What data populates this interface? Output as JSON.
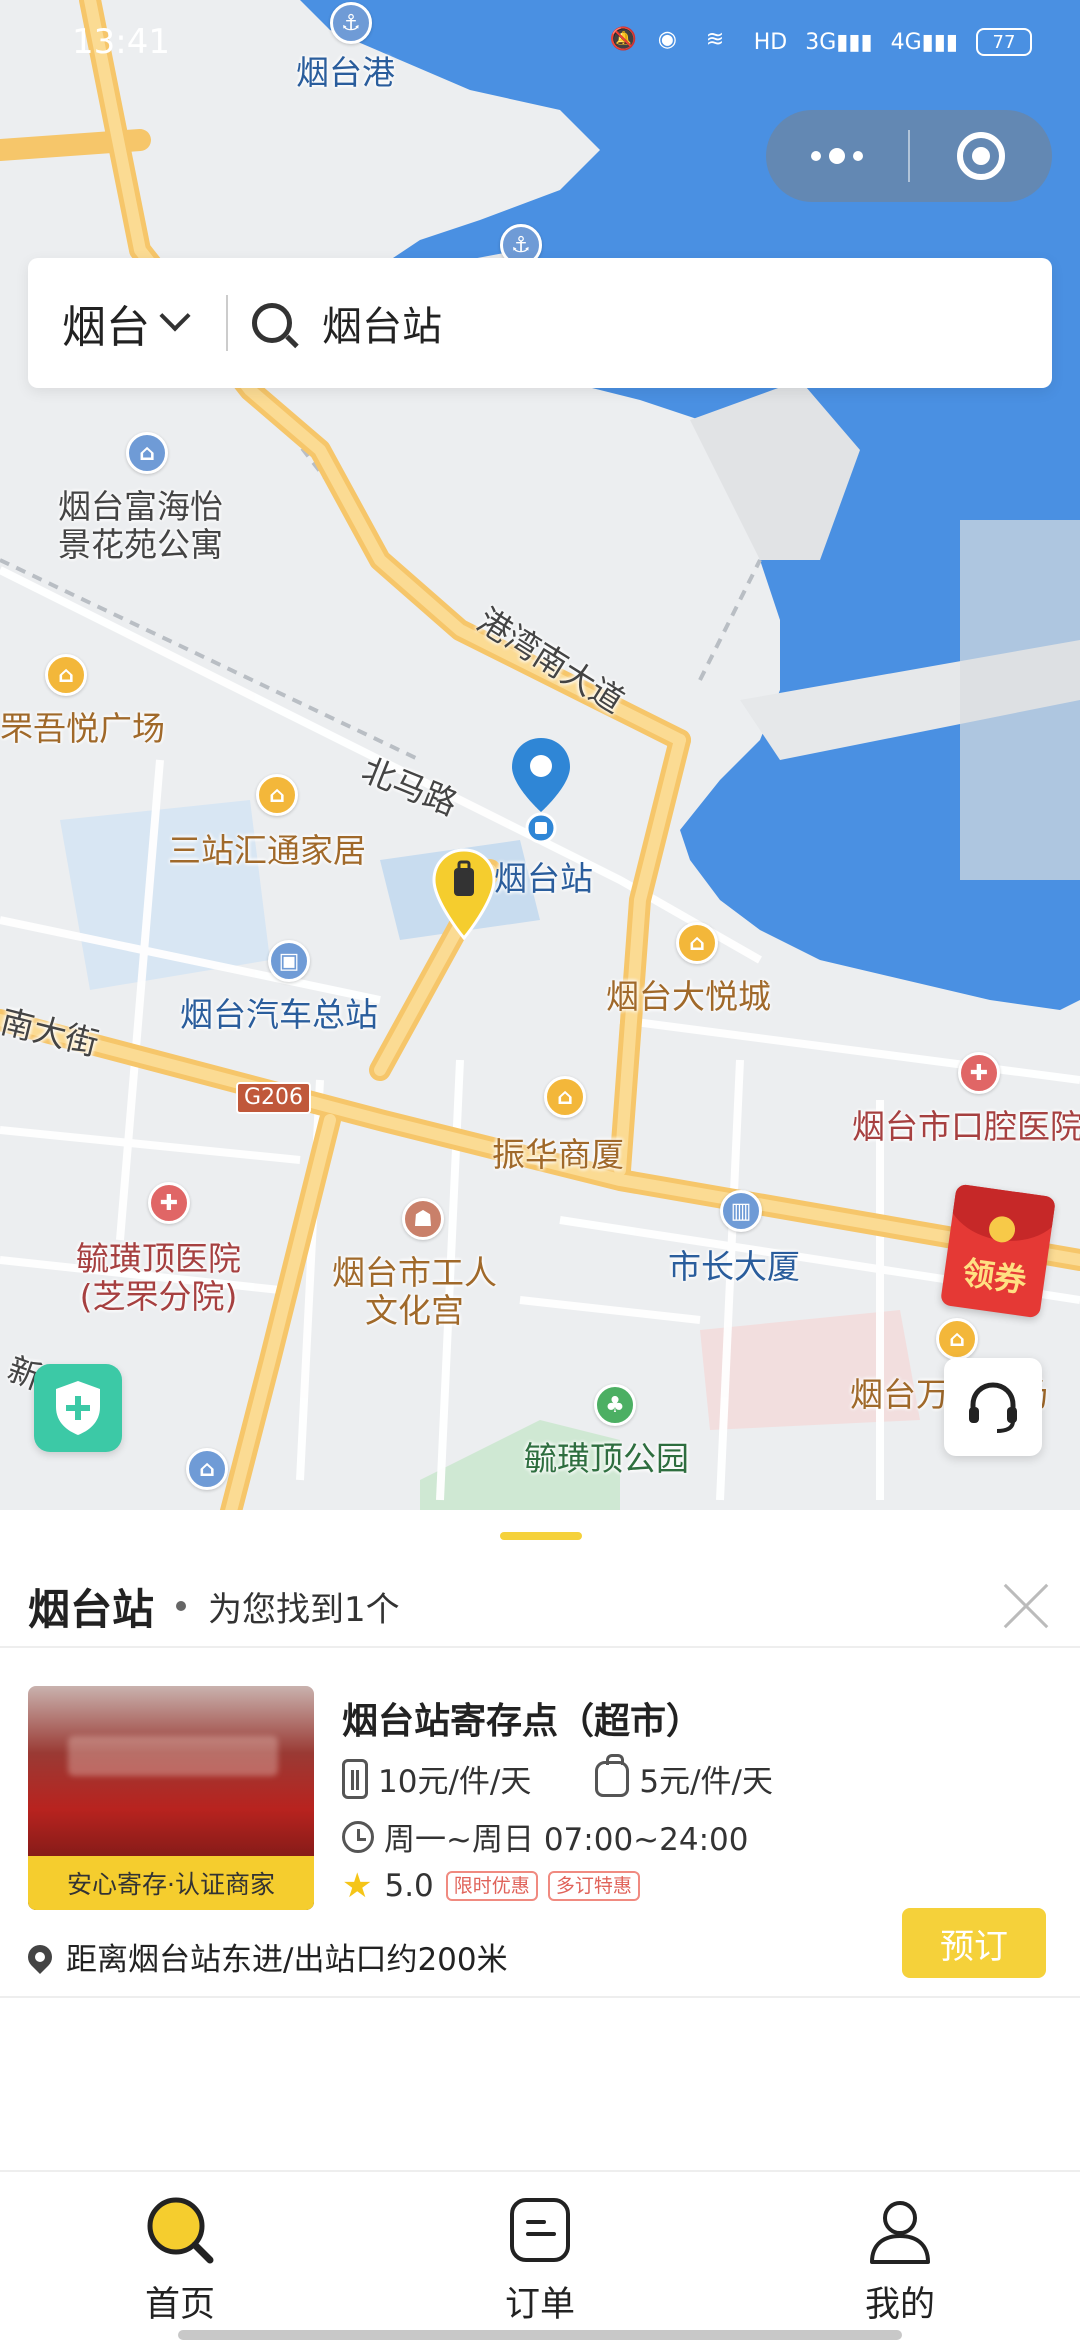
{
  "status_bar": {
    "time": "13:41",
    "battery": "77"
  },
  "search": {
    "city": "烟台",
    "query": "烟台站"
  },
  "map": {
    "labels": {
      "port": "烟台港",
      "apartment": "烟台富海怡\n景花苑公寓",
      "plaza": "罘吾悦广场",
      "home": "三站汇通家居",
      "road_beima": "北马路",
      "road_gangwan": "港湾南大道",
      "station": "烟台站",
      "bus_station": "烟台汽车总站",
      "dayue": "烟台大悦城",
      "nan_street": "南大街",
      "g206": "G206",
      "zhenhua": "振华商厦",
      "dental": "烟台市口腔医院",
      "hospital": "毓璜顶医院\n(芝罘分院)",
      "workers": "烟台市工人\n文化宫",
      "mayor": "市长大厦",
      "wanda": "烟台万达广场",
      "park": "毓璜顶公园",
      "xin_road": "新　路"
    },
    "coupon_label": "领券"
  },
  "results": {
    "station": "烟台站",
    "found_text": "为您找到1个",
    "store": {
      "name": "烟台站寄存点（超市）",
      "badge": "安心寄存·认证商家",
      "price_luggage": "10元/件/天",
      "price_bag": "5元/件/天",
      "hours": "周一~周日 07:00~24:00",
      "rating": "5.0",
      "tags": [
        "限时优惠",
        "多订特惠"
      ],
      "distance": "距离烟台站东进/出站口约200米",
      "book_label": "预订"
    }
  },
  "tabs": [
    {
      "label": "首页",
      "icon": "home-search-icon",
      "active": true
    },
    {
      "label": "订单",
      "icon": "order-icon",
      "active": false
    },
    {
      "label": "我的",
      "icon": "profile-icon",
      "active": false
    }
  ],
  "colors": {
    "accent": "#F5D13A",
    "sea": "#4A90E2",
    "road": "#F8D27B"
  }
}
